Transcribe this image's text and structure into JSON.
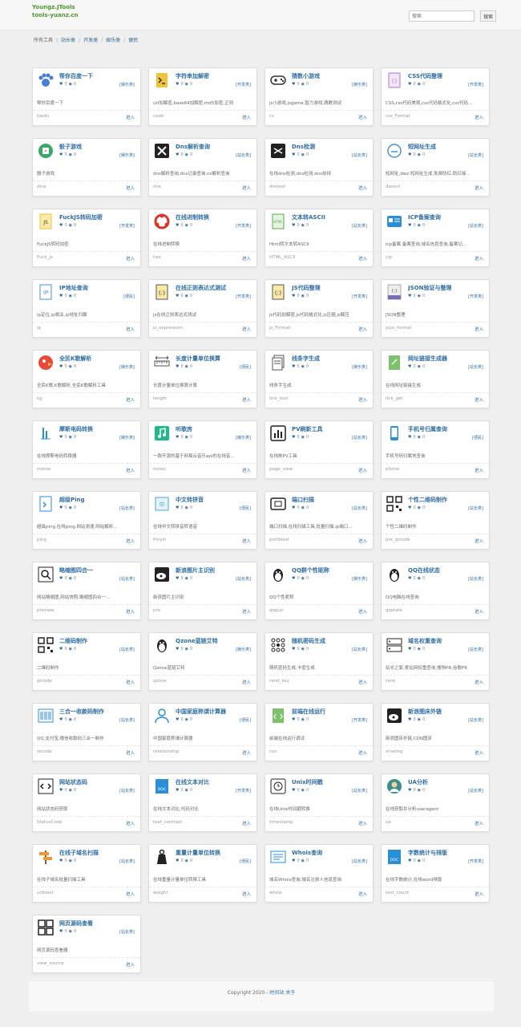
{
  "site": {
    "name_line1": "Youngz.JTools",
    "name_line2": "tools-yuanz.cn"
  },
  "search": {
    "placeholder": "搜索",
    "button": "搜索"
  },
  "breadcrumb": [
    "所有工具",
    "站长类",
    "开发类",
    "娱乐类",
    "便民"
  ],
  "stats": {
    "likes": "0",
    "views": "0"
  },
  "enter_label": "进入",
  "cards": [
    {
      "title": "帮你百度一下",
      "cat": "[娱乐类]",
      "desc": "帮你百度一下",
      "code": "baidu",
      "icon": "paw-icon",
      "color": "#4a7fd6"
    },
    {
      "title": "字符串加解密",
      "cat": "[开发类]",
      "desc": "url加解密,base64加解密,md5加密,正则",
      "code": "code",
      "icon": "terminal-icon",
      "color": "#f2c23a"
    },
    {
      "title": "猜数小游戏",
      "cat": "[娱乐类]",
      "desc": "js小游戏,jsgame,智力游戏,猜数测试",
      "code": "cs",
      "icon": "gamepad-icon",
      "color": "#333333"
    },
    {
      "title": "CSS代码整理",
      "cat": "[开发类]",
      "desc": "CSS,css代码美观,css代码格式化,css代码...",
      "code": "css_Format",
      "icon": "css-file-icon",
      "color": "#b46bd1"
    },
    {
      "title": "骰子游戏",
      "cat": "[娱乐类]",
      "desc": "骰子游戏",
      "code": "dice",
      "icon": "dice-icon",
      "color": "#3aa86b"
    },
    {
      "title": "Dns解析查询",
      "cat": "[站长类]",
      "desc": "dns解析查询,dns记录查询,ns解析查询",
      "code": "dns",
      "icon": "dns-icon",
      "color": "#222222"
    },
    {
      "title": "Dns检测",
      "cat": "[站长类]",
      "desc": "在线dns检测,dns检测,dns劫持",
      "code": "dnstest",
      "icon": "dns-check-icon",
      "color": "#222222"
    },
    {
      "title": "短网址生成",
      "cat": "[站长类]",
      "desc": "短网址,dwz,短网址生成,免费防红,防红接...",
      "code": "dwzurl",
      "icon": "link-cloud-icon",
      "color": "#4a90d9"
    },
    {
      "title": "FuckJS转码加密",
      "cat": "[开发类]",
      "desc": "FuckJS转码加密",
      "code": "Fuck_js",
      "icon": "js-file-icon",
      "color": "#f2c23a"
    },
    {
      "title": "在线进制转换",
      "cat": "[开发类]",
      "desc": "在线进制转换",
      "code": "hex",
      "icon": "hex-icon",
      "color": "#d9352b"
    },
    {
      "title": "文本转ASCII",
      "cat": "[站长类]",
      "desc": "Html转文本转ASCII",
      "code": "HTML_ASCII",
      "icon": "html-file-icon",
      "color": "#5aa84a"
    },
    {
      "title": "ICP备案查询",
      "cat": "[站长类]",
      "desc": "Icp备案,备案查询,域名信息查询,备案记...",
      "code": "icp",
      "icon": "id-card-icon",
      "color": "#2b8fd8"
    },
    {
      "title": "IP地址查询",
      "cat": "[便民]",
      "desc": "ip定位,ip相关,ip地址归属",
      "code": "ip",
      "icon": "ip-icon",
      "color": "#4a90d9"
    },
    {
      "title": "在线正则表达式测试",
      "cat": "[开发类]",
      "desc": "js在线正则表达式测试",
      "code": "js_expression",
      "icon": "regex-icon",
      "color": "#f2c23a"
    },
    {
      "title": "JS代码整理",
      "cat": "[开发类]",
      "desc": "Js代码加解密,js代码格式化,js压缩,js解压",
      "code": "js_Format",
      "icon": "js-code-icon",
      "color": "#f2c23a"
    },
    {
      "title": "JSON验证与整理",
      "cat": "[开发类]",
      "desc": "JSON整理",
      "code": "json_format",
      "icon": "json-icon",
      "color": "#7a6bb5"
    },
    {
      "title": "全民K歌解析",
      "cat": "[娱乐类]",
      "desc": "全民K歌,K歌解析,全民K歌解析工具",
      "code": "kg",
      "icon": "bird-icon",
      "color": "#e84a3a"
    },
    {
      "title": "长度计量单位换算",
      "cat": "[便民]",
      "desc": "长度计量单位换算计算",
      "code": "length",
      "icon": "ruler-icon",
      "color": "#555555"
    },
    {
      "title": "线条字生成",
      "cat": "[娱乐类]",
      "desc": "线条字生成",
      "code": "line_text",
      "icon": "document-stack-icon",
      "color": "#555555"
    },
    {
      "title": "网址链接生成器",
      "cat": "[站长类]",
      "desc": "在线网址链接生成",
      "code": "link_get",
      "icon": "link-file-icon",
      "color": "#5aa84a"
    },
    {
      "title": "摩斯电码转换",
      "cat": "[娱乐类]",
      "desc": "在线摩斯电码转换器",
      "code": "morse",
      "icon": "morse-icon",
      "color": "#2b8fd8"
    },
    {
      "title": "听歌房",
      "cat": "[娱乐类]",
      "desc": "一款开源的基于网易云音乐api的在线音...",
      "code": "mosic",
      "icon": "music-icon",
      "color": "#1fb88a"
    },
    {
      "title": "PV刷新工具",
      "cat": "[站长类]",
      "desc": "在线刷PV工具",
      "code": "page_view",
      "icon": "bar-chart-icon",
      "color": "#222222"
    },
    {
      "title": "手机号归属查询",
      "cat": "[便民]",
      "desc": "手机号码归属地查询",
      "code": "phone",
      "icon": "phone-icon",
      "color": "#2b8fd8"
    },
    {
      "title": "超级Ping",
      "cat": "[站长类]",
      "desc": "超级ping,在线ping,网站测速,网站解析...",
      "code": "ping",
      "icon": "ping-icon",
      "color": "#2b8fd8"
    },
    {
      "title": "中文转拼音",
      "cat": "[便民]",
      "desc": "在线中文转拼音转语音",
      "code": "Pinyin",
      "icon": "pinyin-icon",
      "color": "#4aa8d8"
    },
    {
      "title": "端口扫描",
      "cat": "[站长类]",
      "desc": "端口扫描,在线扫描工具,批量扫描,ip端口...",
      "code": "portblast",
      "icon": "port-icon",
      "color": "#222222"
    },
    {
      "title": "个性二维码制作",
      "cat": "[站长类]",
      "desc": "个性二维码制作",
      "code": "pre_qrcode",
      "icon": "qrcode-icon",
      "color": "#222222"
    },
    {
      "title": "略缩图四合一",
      "cat": "[站长类]",
      "desc": "网站略缩图,网站快照,略缩图四合一...",
      "code": "preview",
      "icon": "magnifier-icon",
      "color": "#222222"
    },
    {
      "title": "新浪图片主识别",
      "cat": "[站长类]",
      "desc": "新浪图片主识别",
      "code": "pro",
      "icon": "weibo-icon",
      "color": "#222222"
    },
    {
      "title": "QQ群个性昵称",
      "cat": "[娱乐类]",
      "desc": "QQ个性昵称",
      "code": "qqqun",
      "icon": "penguin-icon",
      "color": "#222222"
    },
    {
      "title": "QQ在线状态",
      "cat": "[站长类]",
      "desc": "QQ电脑在线查询",
      "code": "qqstate",
      "icon": "penguin-icon",
      "color": "#222222"
    },
    {
      "title": "二维码制作",
      "cat": "[站长类]",
      "desc": "二维码制作",
      "code": "qrcode",
      "icon": "qrcode-icon",
      "color": "#222222"
    },
    {
      "title": "Qzone蓝链艾特",
      "cat": "[娱乐类]",
      "desc": "Qzone蓝链艾特",
      "code": "qzone",
      "icon": "penguin-icon",
      "color": "#222222"
    },
    {
      "title": "随机密码生成",
      "cat": "[站长类]",
      "desc": "随机密码生成,卡密生成",
      "code": "rand_key",
      "icon": "keypad-icon",
      "color": "#222222"
    },
    {
      "title": "域名权重查询",
      "cat": "[站长类]",
      "desc": "站长之家,爱站网权重查询,搜狗PR,谷歌PR",
      "code": "rank",
      "icon": "server-icon",
      "color": "#222222"
    },
    {
      "title": "三合一收款码制作",
      "cat": "[站长类]",
      "desc": "QQ,支付宝,微信收款码三合一制作",
      "code": "recode",
      "icon": "barcode-icon",
      "color": "#2b8fd8"
    },
    {
      "title": "中国家庭称谓计算器",
      "cat": "[便民]",
      "desc": "中国家庭称谓计算器",
      "code": "relationship",
      "icon": "user-icon",
      "color": "#2b8fd8"
    },
    {
      "title": "前端在线运行",
      "cat": "[开发类]",
      "desc": "前端在线运行调试",
      "code": "run",
      "icon": "code-file-icon",
      "color": "#5aa84a"
    },
    {
      "title": "新浪图床外链",
      "cat": "[站长类]",
      "desc": "新浪图床外链,CDN图床",
      "code": "sinaimg",
      "icon": "weibo-icon",
      "color": "#222222"
    },
    {
      "title": "网站状态码",
      "cat": "[站长类]",
      "desc": "网站状态码获取",
      "code": "StatusCode",
      "icon": "code-brackets-icon",
      "color": "#222222"
    },
    {
      "title": "在线文本对比",
      "cat": "[开发类]",
      "desc": "在线文本对比,代码对比",
      "code": "text_contrast",
      "icon": "doc-icon",
      "color": "#2b8fd8"
    },
    {
      "title": "Unix时间戳",
      "cat": "[站长类]",
      "desc": "在线Unix时间戳转换",
      "code": "timestamp",
      "icon": "clock-icon",
      "color": "#222222"
    },
    {
      "title": "UA分析",
      "cat": "[站长类]",
      "desc": "在线获取并分析useragent",
      "code": "ua",
      "icon": "avatar-icon",
      "color": "#3a8f8a"
    },
    {
      "title": "在线子域名扫描",
      "cat": "[站长类]",
      "desc": "在线子域名批量扫描工具",
      "code": "urlblast",
      "icon": "signpost-icon",
      "color": "#e89a3a"
    },
    {
      "title": "重量计量单位转换",
      "cat": "[便民]",
      "desc": "在线重量计量单位转换工具",
      "code": "weight",
      "icon": "weight-icon",
      "color": "#222222"
    },
    {
      "title": "Whois查询",
      "cat": "[站长类]",
      "desc": "域名Whois查询,域名注册人信息查询",
      "code": "whois",
      "icon": "whois-icon",
      "color": "#2b8fd8"
    },
    {
      "title": "字数统计与排版",
      "cat": "[开发类]",
      "desc": "在线字数统计,在线word排版",
      "code": "text_count",
      "icon": "doc-icon",
      "color": "#2b8fd8"
    },
    {
      "title": "网页源码查看",
      "cat": "[站长类]",
      "desc": "网页源码查看器",
      "code": "view_source",
      "icon": "grid-icon",
      "color": "#222222"
    }
  ],
  "footer": {
    "copyright": "Copyright 2020 -",
    "links": "时间站 关于",
    "line2": "·"
  }
}
